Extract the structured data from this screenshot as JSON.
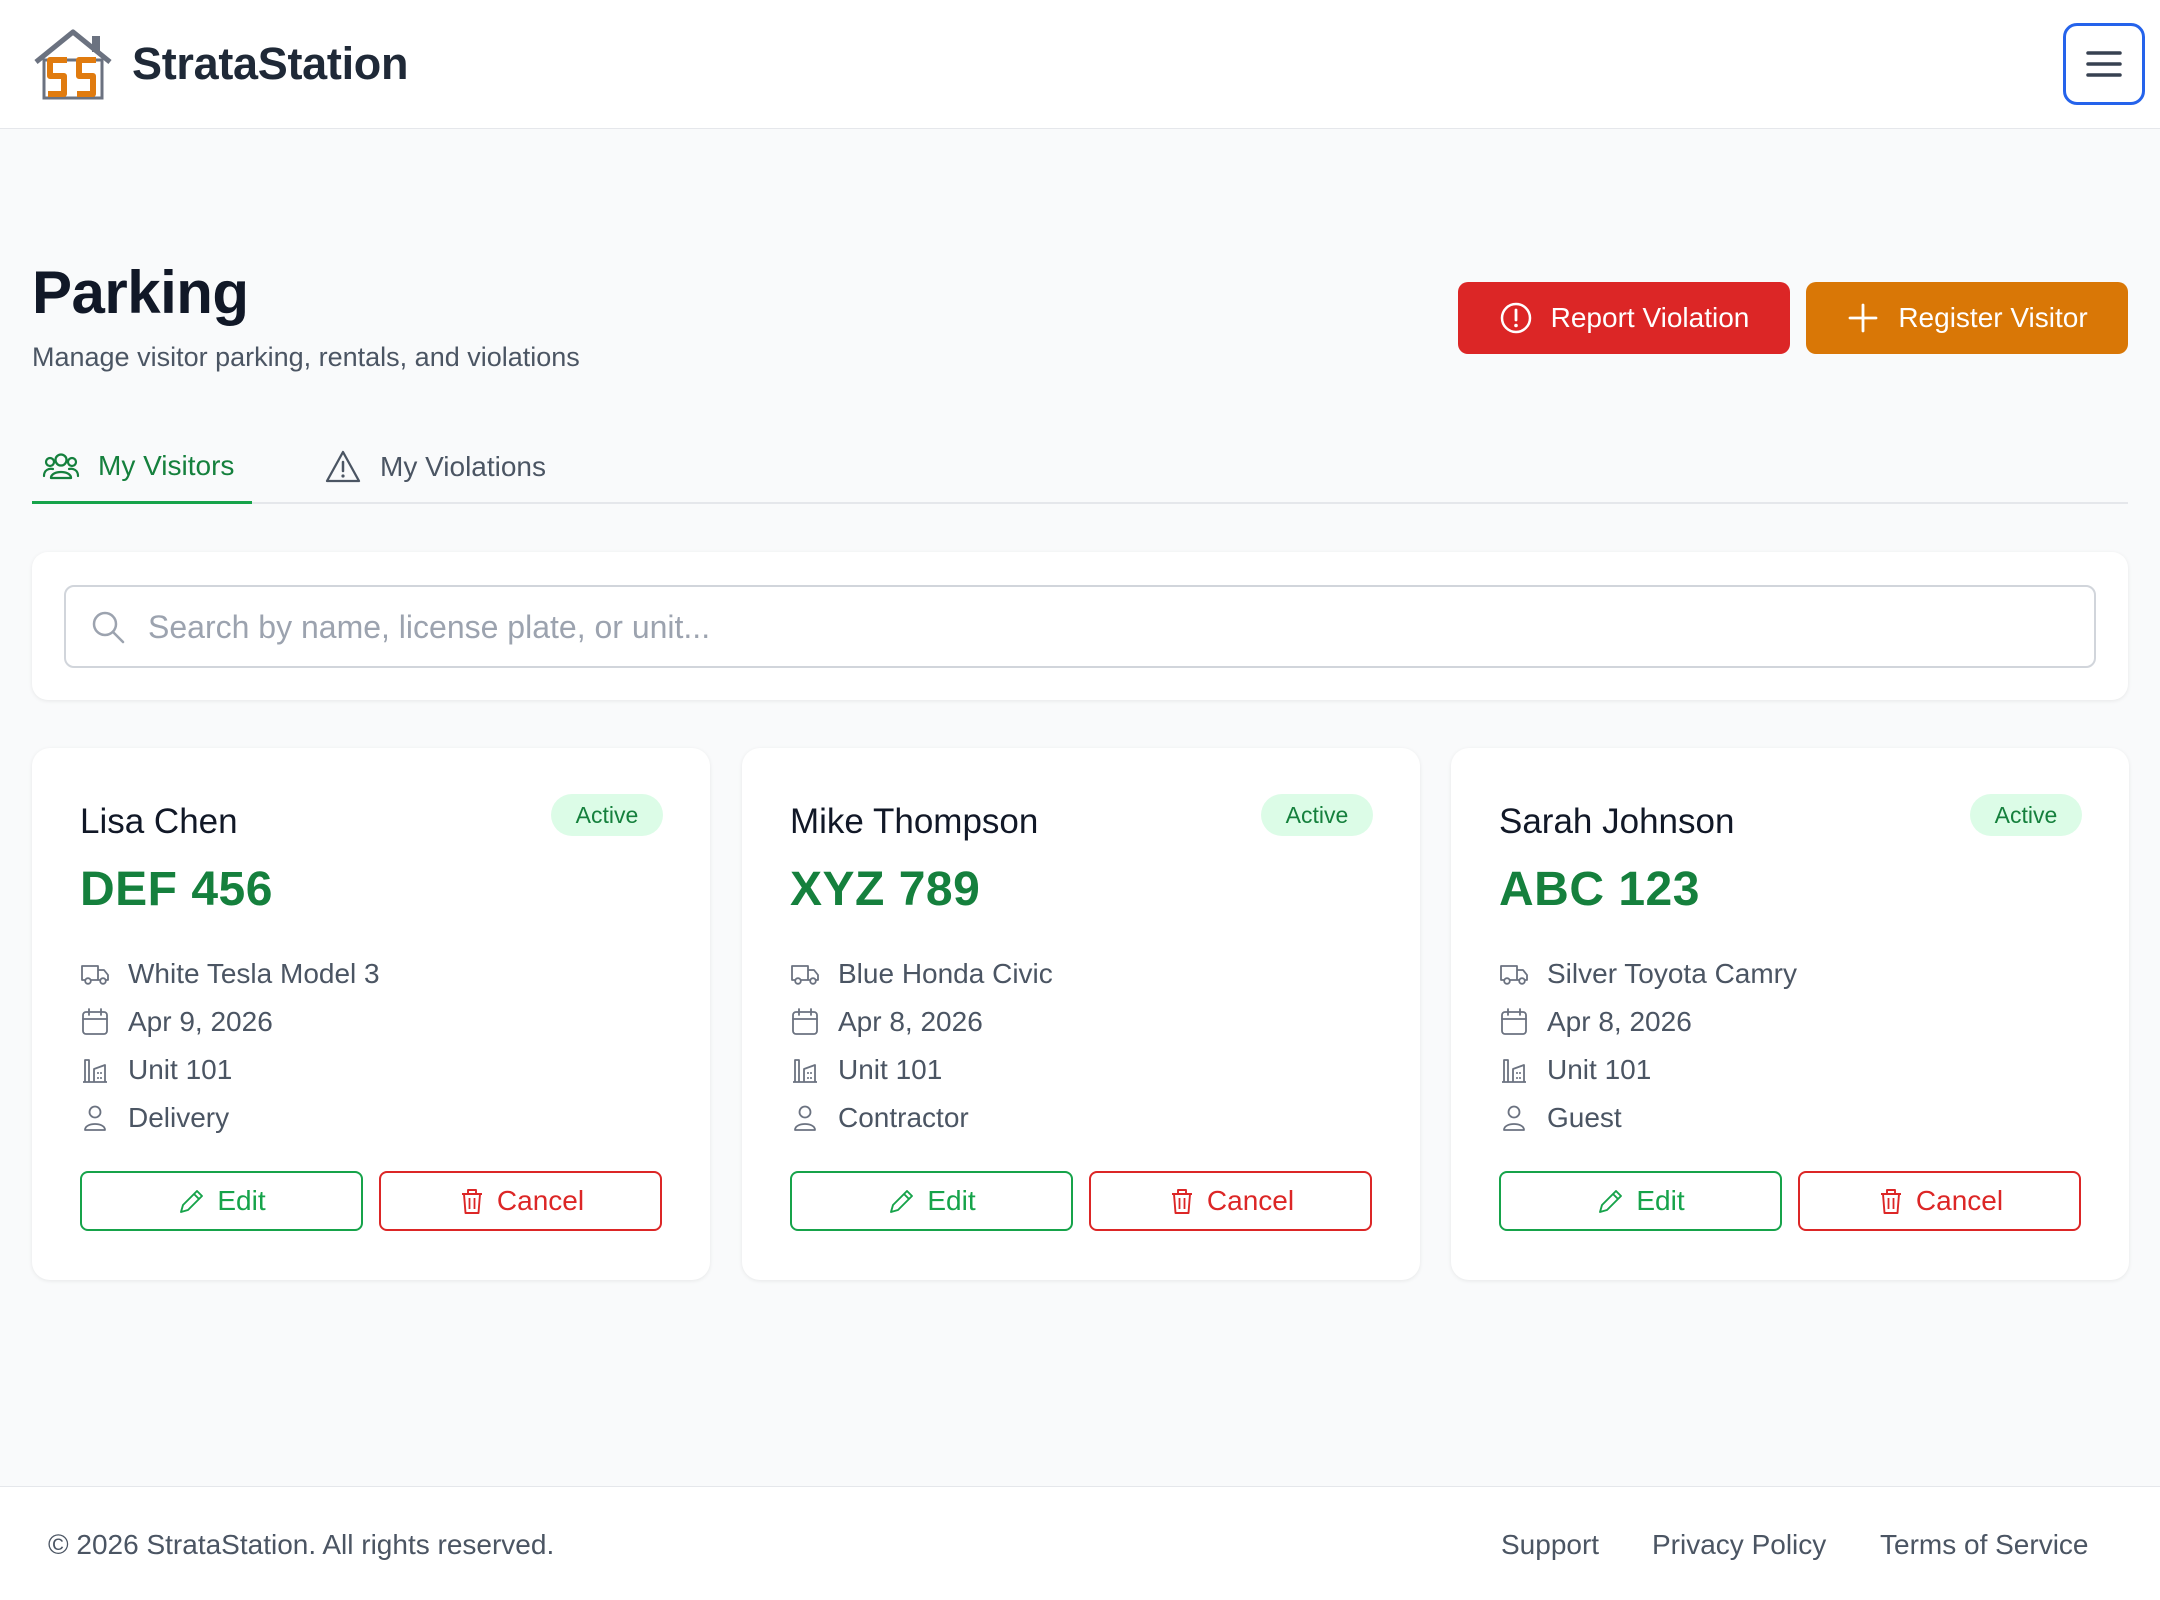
{
  "header": {
    "app_name": "StrataStation",
    "menu_icon": "hamburger-menu-icon"
  },
  "page": {
    "title": "Parking",
    "subtitle": "Manage visitor parking, rentals, and violations"
  },
  "actions": {
    "report_violation": "Report Violation",
    "register_visitor": "Register Visitor"
  },
  "tabs": [
    {
      "label": "My Visitors",
      "icon": "users-icon",
      "active": true
    },
    {
      "label": "My Violations",
      "icon": "warning-triangle-icon",
      "active": false
    }
  ],
  "search": {
    "placeholder": "Search by name, license plate, or unit...",
    "value": ""
  },
  "visitors": [
    {
      "name": "Lisa Chen",
      "plate": "DEF 456",
      "status": "Active",
      "vehicle": "White Tesla Model 3",
      "date": "Apr 9, 2026",
      "unit": "Unit 101",
      "type": "Delivery",
      "edit_label": "Edit",
      "cancel_label": "Cancel"
    },
    {
      "name": "Mike Thompson",
      "plate": "XYZ 789",
      "status": "Active",
      "vehicle": "Blue Honda Civic",
      "date": "Apr 8, 2026",
      "unit": "Unit 101",
      "type": "Contractor",
      "edit_label": "Edit",
      "cancel_label": "Cancel"
    },
    {
      "name": "Sarah Johnson",
      "plate": "ABC 123",
      "status": "Active",
      "vehicle": "Silver Toyota Camry",
      "date": "Apr 8, 2026",
      "unit": "Unit 101",
      "type": "Guest",
      "edit_label": "Edit",
      "cancel_label": "Cancel"
    }
  ],
  "footer": {
    "copyright": "© 2026 StrataStation. All rights reserved.",
    "links": [
      "Support",
      "Privacy Policy",
      "Terms of Service"
    ]
  },
  "colors": {
    "brand_orange": "#d97706",
    "danger_red": "#dc2626",
    "success_green": "#15803d",
    "focus_blue": "#2563eb"
  }
}
